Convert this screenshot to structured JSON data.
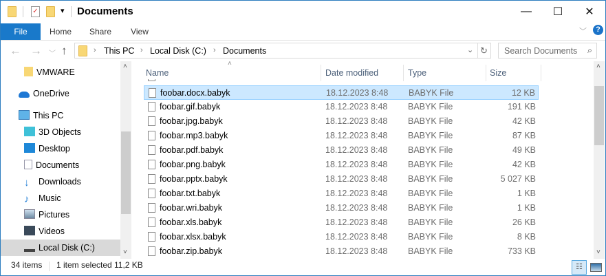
{
  "window": {
    "title": "Documents",
    "minimize": "—",
    "maximize": "☐",
    "close": "✕"
  },
  "ribbon": {
    "tabs": [
      "File",
      "Home",
      "Share",
      "View"
    ],
    "help": "?"
  },
  "address": {
    "crumbs": [
      "This PC",
      "Local Disk (C:)",
      "Documents"
    ],
    "search_placeholder": "Search Documents"
  },
  "nav": {
    "items": [
      {
        "label": "VMWARE",
        "icon": "folder-icon",
        "color": "#f8d775"
      },
      {
        "label": "OneDrive",
        "icon": "cloud-icon",
        "color": "#1e78d4"
      },
      {
        "label": "This PC",
        "icon": "computer-icon",
        "color": "#3a9ad9"
      },
      {
        "label": "3D Objects",
        "icon": "cube-icon",
        "color": "#3fc1d8"
      },
      {
        "label": "Desktop",
        "icon": "desktop-icon",
        "color": "#1e88d8"
      },
      {
        "label": "Documents",
        "icon": "document-icon",
        "color": "#9ab"
      },
      {
        "label": "Downloads",
        "icon": "download-icon",
        "color": "#2e86d8"
      },
      {
        "label": "Music",
        "icon": "music-icon",
        "color": "#2e86d8"
      },
      {
        "label": "Pictures",
        "icon": "pictures-icon",
        "color": "#7a9bb5"
      },
      {
        "label": "Videos",
        "icon": "videos-icon",
        "color": "#345"
      },
      {
        "label": "Local Disk (C:)",
        "icon": "disk-icon",
        "color": "#555"
      }
    ]
  },
  "columns": [
    "Name",
    "Date modified",
    "Type",
    "Size"
  ],
  "files": [
    {
      "name": "foobar.docx.babyk",
      "date": "18.12.2023 8:48",
      "type": "BABYK File",
      "size": "12 KB",
      "selected": true
    },
    {
      "name": "foobar.gif.babyk",
      "date": "18.12.2023 8:48",
      "type": "BABYK File",
      "size": "191 KB"
    },
    {
      "name": "foobar.jpg.babyk",
      "date": "18.12.2023 8:48",
      "type": "BABYK File",
      "size": "42 KB"
    },
    {
      "name": "foobar.mp3.babyk",
      "date": "18.12.2023 8:48",
      "type": "BABYK File",
      "size": "87 KB"
    },
    {
      "name": "foobar.pdf.babyk",
      "date": "18.12.2023 8:48",
      "type": "BABYK File",
      "size": "49 KB"
    },
    {
      "name": "foobar.png.babyk",
      "date": "18.12.2023 8:48",
      "type": "BABYK File",
      "size": "42 KB"
    },
    {
      "name": "foobar.pptx.babyk",
      "date": "18.12.2023 8:48",
      "type": "BABYK File",
      "size": "5 027 KB"
    },
    {
      "name": "foobar.txt.babyk",
      "date": "18.12.2023 8:48",
      "type": "BABYK File",
      "size": "1 KB"
    },
    {
      "name": "foobar.wri.babyk",
      "date": "18.12.2023 8:48",
      "type": "BABYK File",
      "size": "1 KB"
    },
    {
      "name": "foobar.xls.babyk",
      "date": "18.12.2023 8:48",
      "type": "BABYK File",
      "size": "26 KB"
    },
    {
      "name": "foobar.xlsx.babyk",
      "date": "18.12.2023 8:48",
      "type": "BABYK File",
      "size": "8 KB"
    },
    {
      "name": "foobar.zip.babyk",
      "date": "18.12.2023 8:48",
      "type": "BABYK File",
      "size": "733 KB"
    }
  ],
  "status": {
    "count": "34 items",
    "selection": "1 item selected",
    "size": "11,2 KB"
  }
}
